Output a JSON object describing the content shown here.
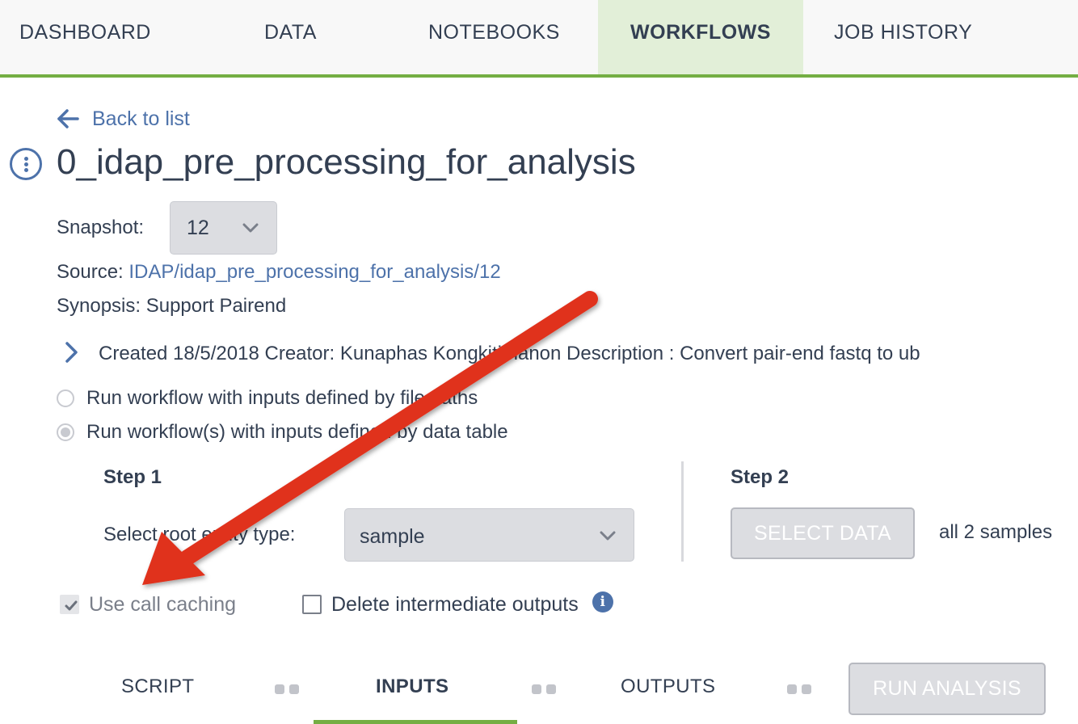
{
  "nav": {
    "tabs": [
      {
        "label": "DASHBOARD"
      },
      {
        "label": "DATA"
      },
      {
        "label": "NOTEBOOKS"
      },
      {
        "label": "WORKFLOWS",
        "active": true
      },
      {
        "label": "JOB HISTORY"
      }
    ]
  },
  "back_link": "Back to list",
  "workflow": {
    "title": "0_idap_pre_processing_for_analysis",
    "snapshot_label": "Snapshot:",
    "snapshot_value": "12",
    "source_label": "Source:",
    "source_value": "IDAP/idap_pre_processing_for_analysis/12",
    "synopsis": "Synopsis: Support Pairend",
    "created": "Created 18/5/2018 Creator: Kunaphas Kongkitimanon Description : Convert pair-end fastq to ub"
  },
  "run_options": {
    "file_paths": "Run workflow with inputs defined by file paths",
    "data_table": "Run workflow(s) with inputs defined by data table",
    "selected": "data_table"
  },
  "step1": {
    "title": "Step 1",
    "root_label": "Select root entity type:",
    "root_value": "sample"
  },
  "step2": {
    "title": "Step 2",
    "select_button": "SELECT DATA",
    "samples_text": "all 2 samples"
  },
  "options": {
    "call_caching": {
      "label": "Use call caching",
      "checked": true
    },
    "delete_intermediate": {
      "label": "Delete intermediate outputs",
      "checked": false
    }
  },
  "bottom_tabs": [
    {
      "label": "SCRIPT"
    },
    {
      "label": "INPUTS",
      "active": true
    },
    {
      "label": "OUTPUTS"
    }
  ],
  "run_button": "RUN ANALYSIS",
  "colors": {
    "accent_green": "#74ae43",
    "link_blue": "#4d72aa",
    "annotation_red": "#e0301e"
  },
  "annotation": {
    "type": "arrow-icon",
    "color": "red"
  }
}
